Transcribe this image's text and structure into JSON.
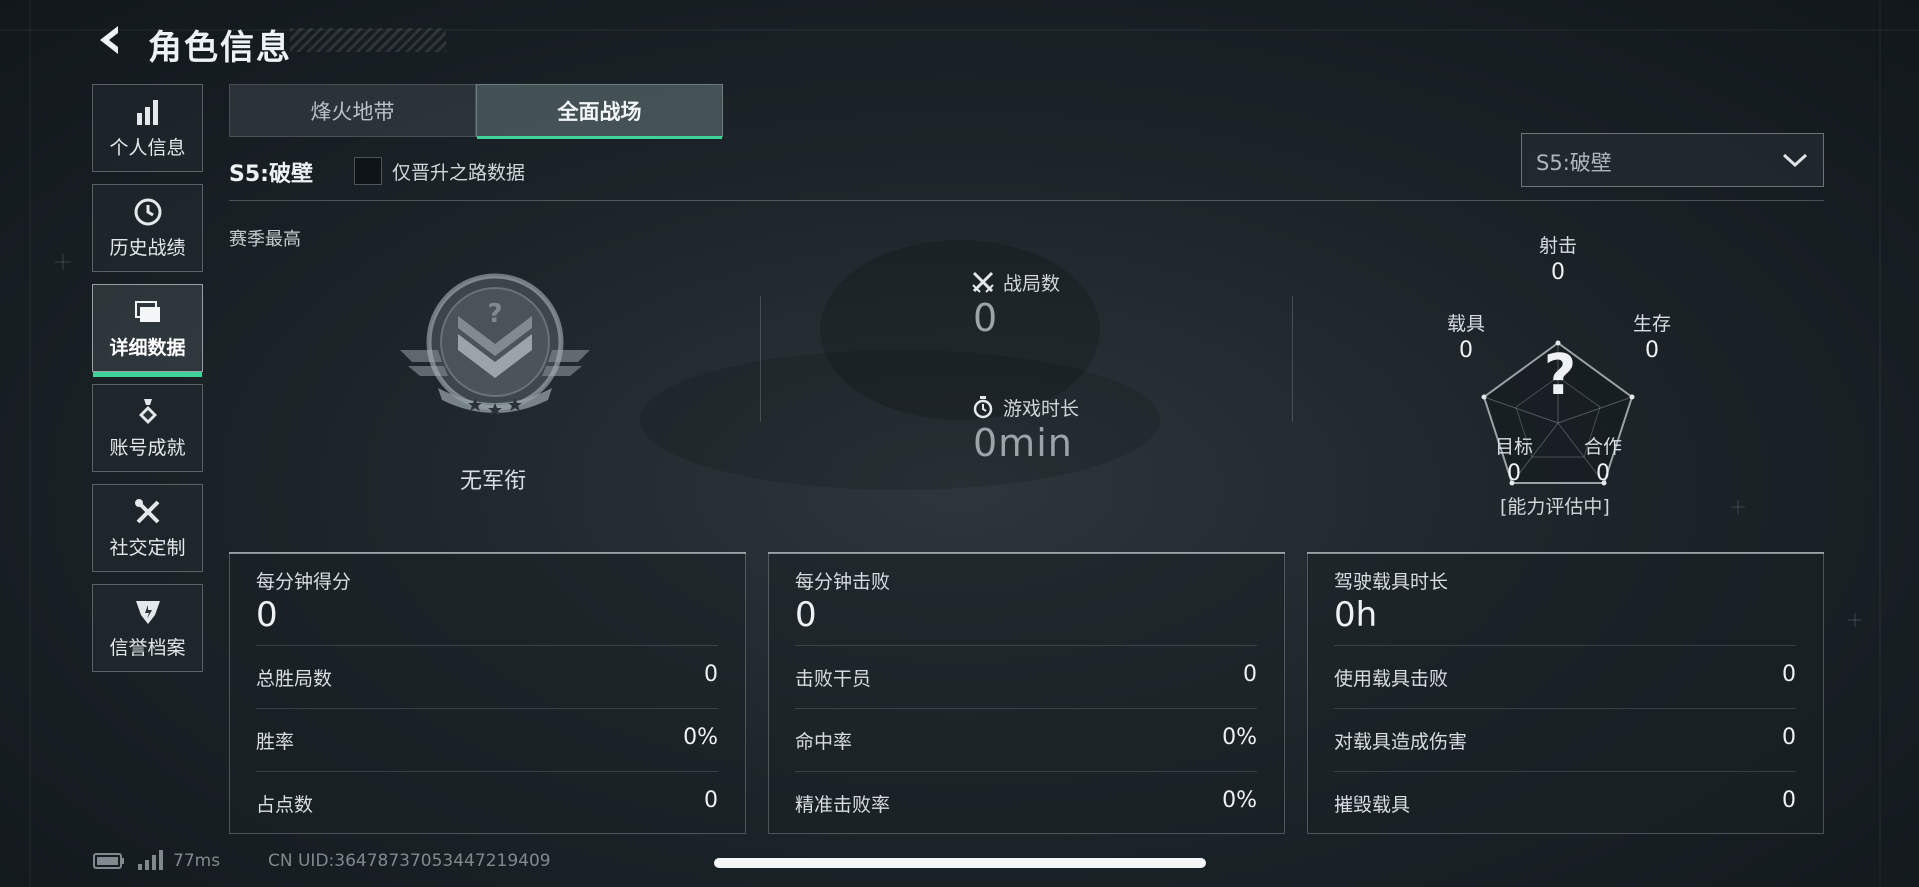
{
  "header": {
    "title": "角色信息"
  },
  "sidebar": {
    "items": [
      {
        "label": "个人信息",
        "icon": "bar-chart-icon",
        "active": false
      },
      {
        "label": "历史战绩",
        "icon": "clock-icon",
        "active": false
      },
      {
        "label": "详细数据",
        "icon": "folders-icon",
        "active": true
      },
      {
        "label": "账号成就",
        "icon": "medal-icon",
        "active": false
      },
      {
        "label": "社交定制",
        "icon": "tools-icon",
        "active": false
      },
      {
        "label": "信誉档案",
        "icon": "shield-emblem-icon",
        "active": false
      }
    ]
  },
  "tabs": [
    {
      "label": "烽火地带",
      "active": false
    },
    {
      "label": "全面战场",
      "active": true
    }
  ],
  "season": {
    "name": "S5:破壁",
    "checkbox_label": "仅晋升之路数据",
    "checkbox_checked": false,
    "dropdown_value": "S5:破壁"
  },
  "overview": {
    "section_label": "赛季最高",
    "rank_name": "无军衔",
    "matches_label": "战局数",
    "matches_value": "0",
    "playtime_label": "游戏时长",
    "playtime_value": "0min"
  },
  "radar": {
    "axes": [
      {
        "label": "射击",
        "value": "0"
      },
      {
        "label": "生存",
        "value": "0"
      },
      {
        "label": "合作",
        "value": "0"
      },
      {
        "label": "目标",
        "value": "0"
      },
      {
        "label": "载具",
        "value": "0"
      }
    ],
    "center_mark": "?",
    "status": "[能力评估中]"
  },
  "panels": [
    {
      "title": "每分钟得分",
      "value": "0",
      "rows": [
        {
          "label": "总胜局数",
          "value": "0"
        },
        {
          "label": "胜率",
          "value": "0%"
        },
        {
          "label": "占点数",
          "value": "0"
        }
      ]
    },
    {
      "title": "每分钟击败",
      "value": "0",
      "rows": [
        {
          "label": "击败干员",
          "value": "0"
        },
        {
          "label": "命中率",
          "value": "0%"
        },
        {
          "label": "精准击败率",
          "value": "0%"
        }
      ]
    },
    {
      "title": "驾驶载具时长",
      "value": "0h",
      "rows": [
        {
          "label": "使用载具击败",
          "value": "0"
        },
        {
          "label": "对载具造成伤害",
          "value": "0"
        },
        {
          "label": "摧毁载具",
          "value": "0"
        }
      ]
    }
  ],
  "footer": {
    "ping": "77ms",
    "uid": "CN UID:36478737053447219409"
  },
  "colors": {
    "accent": "#3fd39a",
    "background": "#1d252a"
  }
}
